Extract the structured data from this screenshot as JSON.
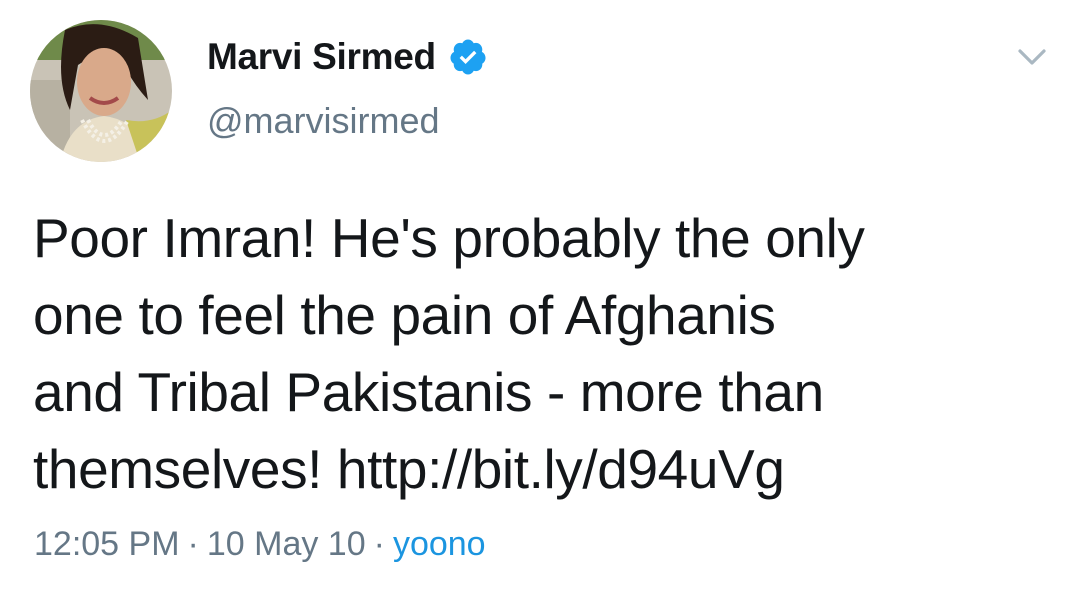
{
  "author": {
    "display_name": "Marvi Sirmed",
    "handle": "@marvisirmed",
    "verified": true
  },
  "tweet": {
    "text_lines": [
      "Poor Imran! He's probably the only",
      "one to feel the pain of Afghanis",
      "and Tribal Pakistanis - more than",
      "themselves! http://bit.ly/d94uVg"
    ]
  },
  "meta": {
    "time": "12:05 PM",
    "separator": "·",
    "date": "10 May 10",
    "source": "yoono"
  },
  "icons": {
    "verified": "verified-badge-icon",
    "menu": "chevron-down-icon"
  },
  "colors": {
    "text": "#14171a",
    "secondary": "#657786",
    "link": "#1b95e0",
    "verified": "#1da1f2"
  }
}
